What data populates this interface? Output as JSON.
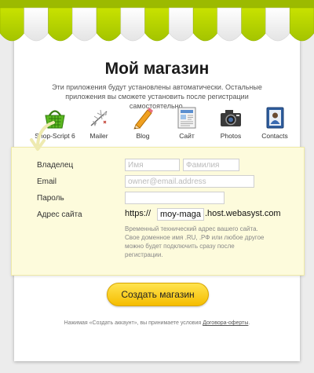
{
  "header": {
    "title": "Мой магазин",
    "subtitle": "Эти приложения будут установлены автоматически. Остальные приложения вы сможете установить после регистрации самостоятельно."
  },
  "apps": [
    {
      "label": "Shop-Script 6",
      "icon": "basket-icon"
    },
    {
      "label": "Mailer",
      "icon": "mailer-icon"
    },
    {
      "label": "Blog",
      "icon": "pencil-icon"
    },
    {
      "label": "Сайт",
      "icon": "site-icon"
    },
    {
      "label": "Photos",
      "icon": "camera-icon"
    },
    {
      "label": "Contacts",
      "icon": "contacts-icon"
    }
  ],
  "form": {
    "owner_label": "Владелец",
    "first_name_placeholder": "Имя",
    "last_name_placeholder": "Фамилия",
    "email_label": "Email",
    "email_placeholder": "owner@email.address",
    "password_label": "Пароль",
    "site_label": "Адрес сайта",
    "url_prefix": "https://",
    "subdomain_value": "moy-magazin",
    "url_suffix": ".host.webasyst.com",
    "hint": "Временный технический адрес вашего сайта. Свое доменное имя .RU, .РФ или любое другое можно будет подключить сразу после регистрации."
  },
  "submit_label": "Создать магазин",
  "footer": {
    "text": "Нажимая «Создать аккаунт», вы принимаете условия ",
    "link": "Договора-оферты",
    "end": "."
  },
  "colors": {
    "awning_green": "#b6d500",
    "awning_white": "#ffffff",
    "form_bg": "#fdfbdc",
    "button": "#f5c400"
  }
}
